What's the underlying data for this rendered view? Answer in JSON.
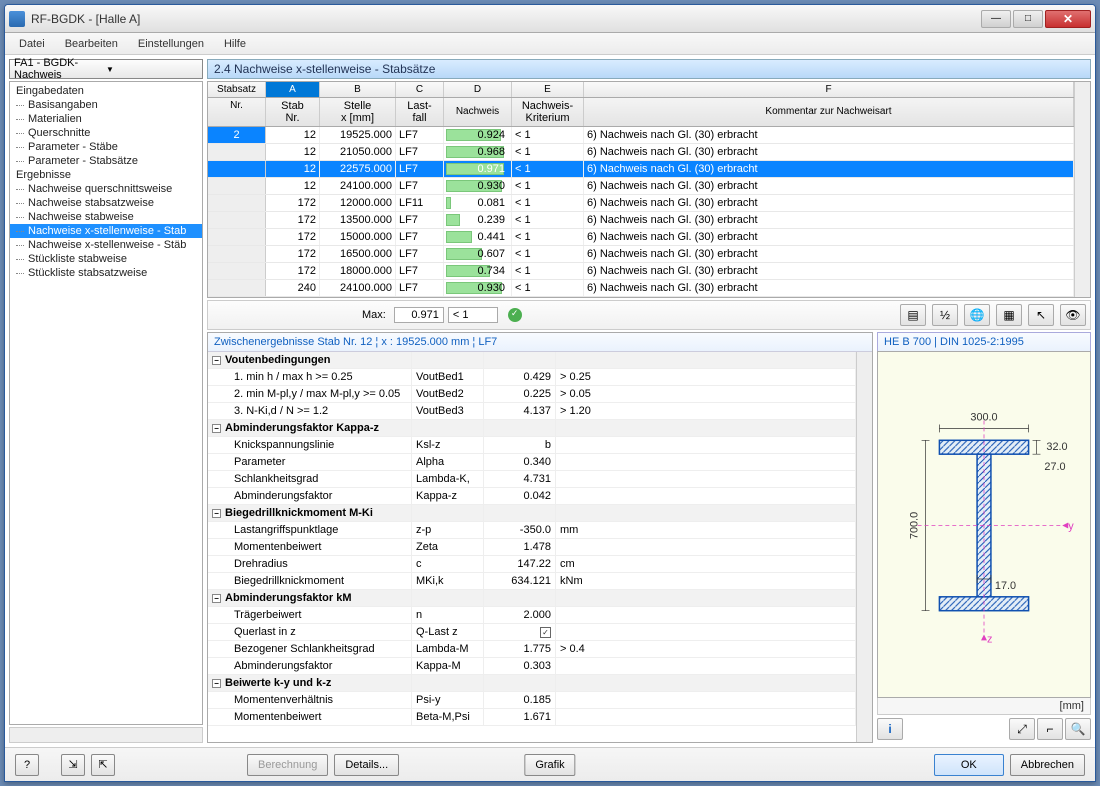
{
  "title": "RF-BGDK - [Halle A]",
  "menu": [
    "Datei",
    "Bearbeiten",
    "Einstellungen",
    "Hilfe"
  ],
  "dropdown": "FA1 - BGDK-Nachweis",
  "tree": {
    "groups": [
      {
        "label": "Eingabedaten",
        "items": [
          "Basisangaben",
          "Materialien",
          "Querschnitte",
          "Parameter - Stäbe",
          "Parameter - Stabsätze"
        ]
      },
      {
        "label": "Ergebnisse",
        "items": [
          "Nachweise querschnittsweise",
          "Nachweise stabsatzweise",
          "Nachweise stabweise",
          "Nachweise x-stellenweise - Stab",
          "Nachweise x-stellenweise - Stäb",
          "Stückliste stabweise",
          "Stückliste stabsatzweise"
        ]
      }
    ],
    "selected": "Nachweise x-stellenweise - Stab"
  },
  "main_title": "2.4 Nachweise x-stellenweise - Stabsätze",
  "table": {
    "cols": [
      "A",
      "B",
      "C",
      "D",
      "E",
      "F"
    ],
    "heads": {
      "stab": "Stabsatz",
      "nr": "Nr.",
      "a1": "Stab",
      "a2": "Nr.",
      "b1": "Stelle",
      "b2": "x [mm]",
      "c1": "Last-",
      "c2": "fall",
      "d": "Nachweis",
      "e1": "Nachweis-",
      "e2": "Kriterium",
      "f": "Kommentar zur Nachweisart"
    },
    "rows": [
      {
        "set": "2",
        "stab": "12",
        "x": "19525.000",
        "lf": "LF7",
        "nw": 0.924,
        "kr": "< 1",
        "kom": "6) Nachweis nach Gl. (30) erbracht"
      },
      {
        "set": "",
        "stab": "12",
        "x": "21050.000",
        "lf": "LF7",
        "nw": 0.968,
        "kr": "< 1",
        "kom": "6) Nachweis nach Gl. (30) erbracht"
      },
      {
        "set": "",
        "stab": "12",
        "x": "22575.000",
        "lf": "LF7",
        "nw": 0.971,
        "kr": "< 1",
        "kom": "6) Nachweis nach Gl. (30) erbracht",
        "sel": true
      },
      {
        "set": "",
        "stab": "12",
        "x": "24100.000",
        "lf": "LF7",
        "nw": 0.93,
        "kr": "< 1",
        "kom": "6) Nachweis nach Gl. (30) erbracht"
      },
      {
        "set": "",
        "stab": "172",
        "x": "12000.000",
        "lf": "LF11",
        "nw": 0.081,
        "kr": "< 1",
        "kom": "6) Nachweis nach Gl. (30) erbracht"
      },
      {
        "set": "",
        "stab": "172",
        "x": "13500.000",
        "lf": "LF7",
        "nw": 0.239,
        "kr": "< 1",
        "kom": "6) Nachweis nach Gl. (30) erbracht"
      },
      {
        "set": "",
        "stab": "172",
        "x": "15000.000",
        "lf": "LF7",
        "nw": 0.441,
        "kr": "< 1",
        "kom": "6) Nachweis nach Gl. (30) erbracht"
      },
      {
        "set": "",
        "stab": "172",
        "x": "16500.000",
        "lf": "LF7",
        "nw": 0.607,
        "kr": "< 1",
        "kom": "6) Nachweis nach Gl. (30) erbracht"
      },
      {
        "set": "",
        "stab": "172",
        "x": "18000.000",
        "lf": "LF7",
        "nw": 0.734,
        "kr": "< 1",
        "kom": "6) Nachweis nach Gl. (30) erbracht"
      },
      {
        "set": "",
        "stab": "240",
        "x": "24100.000",
        "lf": "LF7",
        "nw": 0.93,
        "kr": "< 1",
        "kom": "6) Nachweis nach Gl. (30) erbracht"
      }
    ],
    "max_label": "Max:",
    "max_val": "0.971",
    "max_kr": "< 1"
  },
  "details": {
    "header": "Zwischenergebnisse Stab Nr. 12 ¦ x : 19525.000 mm ¦ LF7",
    "groups": [
      {
        "title": "Voutenbedingungen",
        "rows": [
          {
            "p": "1. min h / max h >= 0.25",
            "s": "VoutBed1",
            "v": "0.429",
            "u": "> 0.25"
          },
          {
            "p": "2. min M-pl,y / max M-pl,y >= 0.05",
            "s": "VoutBed2",
            "v": "0.225",
            "u": "> 0.05"
          },
          {
            "p": "3. N-Ki,d / N >= 1.2",
            "s": "VoutBed3",
            "v": "4.137",
            "u": "> 1.20"
          }
        ]
      },
      {
        "title": "Abminderungsfaktor Kappa-z",
        "rows": [
          {
            "p": "Knickspannungslinie",
            "s": "Ksl-z",
            "v": "b",
            "u": ""
          },
          {
            "p": "Parameter",
            "s": "Alpha",
            "v": "0.340",
            "u": ""
          },
          {
            "p": "Schlankheitsgrad",
            "s": "Lambda-K,",
            "v": "4.731",
            "u": ""
          },
          {
            "p": "Abminderungsfaktor",
            "s": "Kappa-z",
            "v": "0.042",
            "u": ""
          }
        ]
      },
      {
        "title": "Biegedrillknickmoment M-Ki",
        "rows": [
          {
            "p": "Lastangriffspunktlage",
            "s": "z-p",
            "v": "-350.0",
            "u": "mm"
          },
          {
            "p": "Momentenbeiwert",
            "s": "Zeta",
            "v": "1.478",
            "u": ""
          },
          {
            "p": "Drehradius",
            "s": "c",
            "v": "147.22",
            "u": "cm"
          },
          {
            "p": "Biegedrillknickmoment",
            "s": "MKi,k",
            "v": "634.121",
            "u": "kNm"
          }
        ]
      },
      {
        "title": "Abminderungsfaktor kM",
        "rows": [
          {
            "p": "Trägerbeiwert",
            "s": "n",
            "v": "2.000",
            "u": ""
          },
          {
            "p": "Querlast in z",
            "s": "Q-Last z",
            "v": "",
            "u": "",
            "chk": true
          },
          {
            "p": "Bezogener Schlankheitsgrad",
            "s": "Lambda-M",
            "v": "1.775",
            "u": "> 0.4"
          },
          {
            "p": "Abminderungsfaktor",
            "s": "Kappa-M",
            "v": "0.303",
            "u": ""
          }
        ]
      },
      {
        "title": "Beiwerte k-y und k-z",
        "rows": [
          {
            "p": "Momentenverhältnis",
            "s": "Psi-y",
            "v": "0.185",
            "u": ""
          },
          {
            "p": "Momentenbeiwert",
            "s": "Beta-M,Psi",
            "v": "1.671",
            "u": ""
          }
        ]
      }
    ]
  },
  "profile": {
    "title": "HE B 700 | DIN 1025-2:1995",
    "dims": {
      "b": "300.0",
      "h": "700.0",
      "tf": "32.0",
      "tw": "17.0",
      "r": "27.0"
    },
    "unit": "[mm]"
  },
  "footer": {
    "berechnung": "Berechnung",
    "details": "Details...",
    "grafik": "Grafik",
    "ok": "OK",
    "abbrechen": "Abbrechen"
  }
}
